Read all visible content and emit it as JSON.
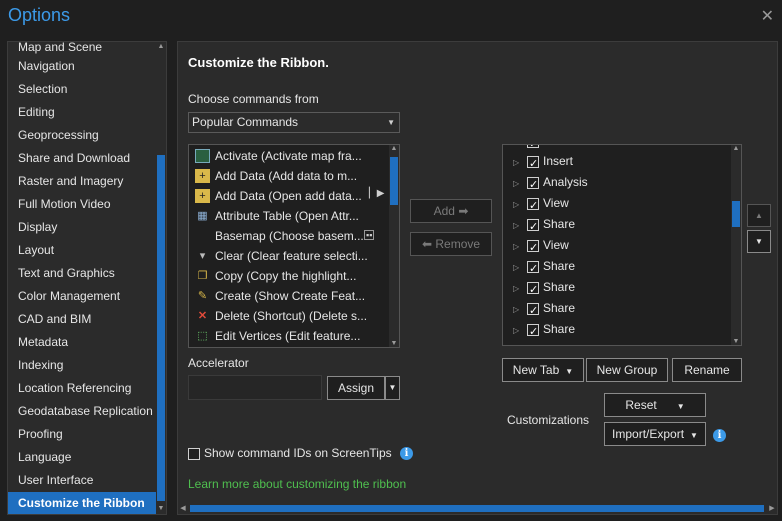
{
  "window": {
    "title": "Options"
  },
  "sidebar": {
    "items": [
      {
        "label": "Map and Scene"
      },
      {
        "label": "Navigation"
      },
      {
        "label": "Selection"
      },
      {
        "label": "Editing"
      },
      {
        "label": "Geoprocessing"
      },
      {
        "label": "Share and Download"
      },
      {
        "label": "Raster and Imagery"
      },
      {
        "label": "Full Motion Video"
      },
      {
        "label": "Display"
      },
      {
        "label": "Layout"
      },
      {
        "label": "Text and Graphics"
      },
      {
        "label": "Color Management"
      },
      {
        "label": "CAD and BIM"
      },
      {
        "label": "Metadata"
      },
      {
        "label": "Indexing"
      },
      {
        "label": "Location Referencing"
      },
      {
        "label": "Geodatabase Replication"
      },
      {
        "label": "Proofing"
      },
      {
        "label": "Language"
      },
      {
        "label": "User Interface"
      },
      {
        "label": "Customize the Ribbon"
      }
    ],
    "selected": "Customize the Ribbon"
  },
  "panel": {
    "heading": "Customize the Ribbon.",
    "choose_label": "Choose commands from",
    "choose_value": "Popular Commands",
    "commands": [
      {
        "label": "Activate (Activate map fra...",
        "icon": "map-frame-icon"
      },
      {
        "label": "Add Data (Add data to m...",
        "icon": "add-data-icon"
      },
      {
        "label": "Add Data (Open add data...",
        "icon": "add-data-icon"
      },
      {
        "label": "Attribute Table (Open Attr...",
        "icon": "table-icon"
      },
      {
        "label": "Basemap (Choose basem...",
        "icon": ""
      },
      {
        "label": "Clear (Clear feature selecti...",
        "icon": "clear-selection-icon"
      },
      {
        "label": "Copy (Copy the highlight...",
        "icon": "copy-icon"
      },
      {
        "label": "Create (Show Create Feat...",
        "icon": "create-features-icon"
      },
      {
        "label": "Delete (Shortcut) (Delete s...",
        "icon": "delete-icon"
      },
      {
        "label": "Edit Vertices (Edit feature...",
        "icon": "edit-vertices-icon"
      }
    ],
    "add_label": "Add",
    "remove_label": "Remove",
    "tabs": [
      {
        "label": "Insert",
        "checked": true
      },
      {
        "label": "Analysis",
        "checked": true
      },
      {
        "label": "View",
        "checked": true
      },
      {
        "label": "Share",
        "checked": true
      },
      {
        "label": "View",
        "checked": true
      },
      {
        "label": "Share",
        "checked": true
      },
      {
        "label": "Share",
        "checked": true
      },
      {
        "label": "Share",
        "checked": true
      },
      {
        "label": "Share",
        "checked": true
      }
    ],
    "accelerator_label": "Accelerator",
    "accelerator_value": "",
    "assign_label": "Assign",
    "new_tab_label": "New Tab",
    "new_group_label": "New Group",
    "rename_label": "Rename",
    "customizations_label": "Customizations",
    "reset_label": "Reset",
    "import_export_label": "Import/Export",
    "show_ids_label": "Show command IDs on ScreenTips",
    "show_ids_checked": false,
    "learn_more_label": "Learn more about customizing the ribbon"
  },
  "colors": {
    "accent": "#1f6fc0",
    "title": "#3c9ae8",
    "link": "#4fbf4f",
    "background": "#2b2b2b"
  }
}
